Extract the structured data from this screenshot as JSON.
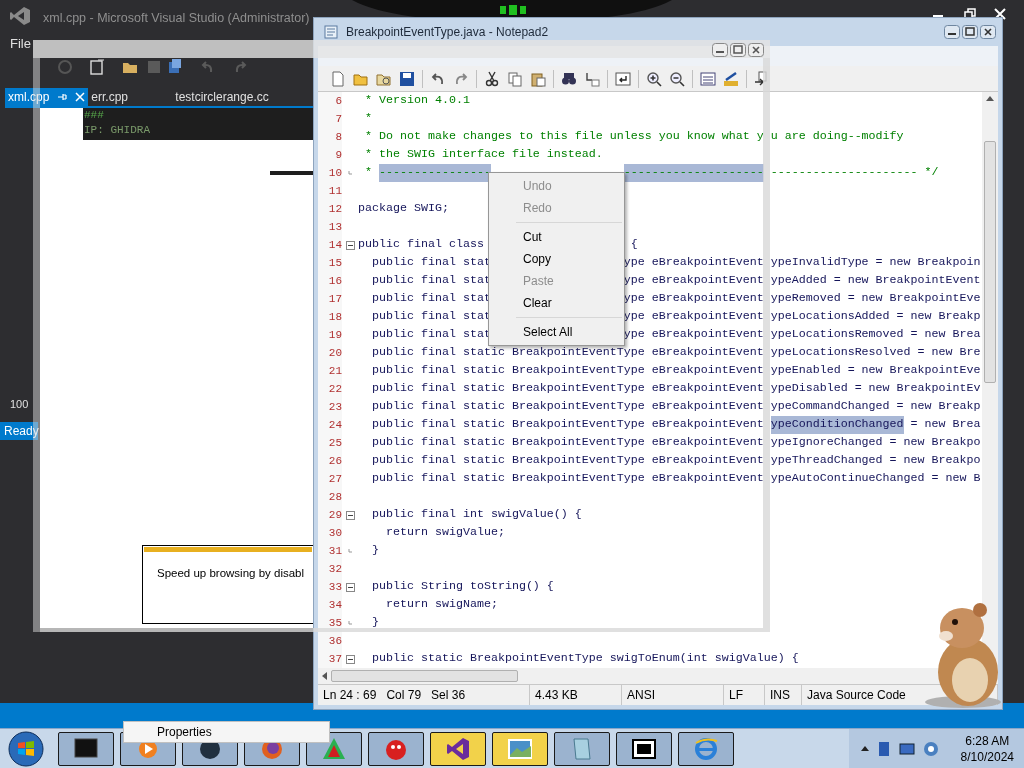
{
  "vs": {
    "title": "xml.cpp - Microsoft Visual Studio (Administrator)",
    "menu": [
      "File"
    ],
    "tabs": [
      {
        "label": "xml.cpp",
        "selected": true
      },
      {
        "label": "err.cpp",
        "selected": false
      },
      {
        "label": "testcirclerange.cc",
        "selected": false
      }
    ],
    "output_lines": [
      "###",
      "IP: GHIDRA"
    ],
    "zoom": "100",
    "status": "Ready"
  },
  "overlay_window": {
    "notification": "Speed up browsing by disabl"
  },
  "notepad": {
    "title": "BreakpointEventType.java - Notepad2",
    "lines": [
      {
        "number": "6",
        "kind": "comment",
        "left": [
          {
            "text": " * Version 4.0.1",
            "selected": false
          }
        ]
      },
      {
        "number": "7",
        "kind": "comment",
        "left": [
          {
            "text": " *",
            "selected": false
          }
        ]
      },
      {
        "number": "8",
        "kind": "comment",
        "left": [
          {
            "text": " * Do not make changes to this file unless you know what y",
            "selected": false
          }
        ],
        "right": [
          {
            "text": "u are doing--modify",
            "selected": false
          }
        ]
      },
      {
        "number": "9",
        "kind": "comment",
        "left": [
          {
            "text": " * the SWIG interface file instead.",
            "selected": false
          }
        ]
      },
      {
        "number": "10",
        "kind": "comment",
        "block_end": true,
        "left": [
          {
            "text": " * ",
            "selected": false
          },
          {
            "text": "----------------",
            "selected": true
          }
        ],
        "mid": [
          {
            "text": "--------------------",
            "selected": true
          }
        ],
        "right": [
          {
            "text": "--------------------- */",
            "selected": false
          }
        ]
      },
      {
        "number": "11",
        "kind": "blank"
      },
      {
        "number": "12",
        "kind": "code",
        "left": [
          {
            "text": "package SWIG;",
            "selected": false
          }
        ]
      },
      {
        "number": "13",
        "kind": "blank"
      },
      {
        "number": "14",
        "kind": "code",
        "collapsible": true,
        "left": [
          {
            "text": "public final class ",
            "selected": false
          }
        ],
        "mid": [
          {
            "text": " {",
            "selected": false
          }
        ]
      },
      {
        "number": "15",
        "kind": "code",
        "left": [
          {
            "text": "  public final stat",
            "selected": false
          }
        ],
        "mid": [
          {
            "text": "ype eBreakpointEvent",
            "selected": false
          }
        ],
        "right": [
          {
            "text": "ypeInvalidType = new Breakpoin",
            "selected": false
          }
        ]
      },
      {
        "number": "16",
        "kind": "code",
        "left": [
          {
            "text": "  public final stat",
            "selected": false
          }
        ],
        "mid": [
          {
            "text": "ype eBreakpointEvent",
            "selected": false
          }
        ],
        "right": [
          {
            "text": "ypeAdded = new BreakpointEvent",
            "selected": false
          }
        ]
      },
      {
        "number": "17",
        "kind": "code",
        "left": [
          {
            "text": "  public final stat",
            "selected": false
          }
        ],
        "mid": [
          {
            "text": "ype eBreakpointEvent",
            "selected": false
          }
        ],
        "right": [
          {
            "text": "ypeRemoved = new BreakpointEve",
            "selected": false
          }
        ]
      },
      {
        "number": "18",
        "kind": "code",
        "left": [
          {
            "text": "  public final stat",
            "selected": false
          }
        ],
        "mid": [
          {
            "text": "ype eBreakpointEvent",
            "selected": false
          }
        ],
        "right": [
          {
            "text": "ypeLocationsAdded = new Breakp",
            "selected": false
          }
        ]
      },
      {
        "number": "19",
        "kind": "code",
        "left": [
          {
            "text": "  public final stat",
            "selected": false
          }
        ],
        "mid": [
          {
            "text": "ype eBreakpointEvent",
            "selected": false
          }
        ],
        "right": [
          {
            "text": "ypeLocationsRemoved = new Brea",
            "selected": false
          }
        ]
      },
      {
        "number": "20",
        "kind": "code",
        "left": [
          {
            "text": "  public final static BreakpointEventType eBreakpointEvent",
            "selected": false
          }
        ],
        "right": [
          {
            "text": "ypeLocationsResolved = new Bre",
            "selected": false
          }
        ]
      },
      {
        "number": "21",
        "kind": "code",
        "left": [
          {
            "text": "  public final static BreakpointEventType eBreakpointEvent",
            "selected": false
          }
        ],
        "right": [
          {
            "text": "ypeEnabled = new BreakpointEve",
            "selected": false
          }
        ]
      },
      {
        "number": "22",
        "kind": "code",
        "left": [
          {
            "text": "  public final static BreakpointEventType eBreakpointEvent",
            "selected": false
          }
        ],
        "right": [
          {
            "text": "ypeDisabled = new BreakpointEv",
            "selected": false
          }
        ]
      },
      {
        "number": "23",
        "kind": "code",
        "left": [
          {
            "text": "  public final static BreakpointEventType eBreakpointEvent",
            "selected": false
          }
        ],
        "right": [
          {
            "text": "ypeCommandChanged = new Breakp",
            "selected": false
          }
        ]
      },
      {
        "number": "24",
        "kind": "code",
        "left": [
          {
            "text": "  public final static BreakpointEventType eBreakpointEvent",
            "selected": false
          }
        ],
        "right": [
          {
            "text": "ypeConditionChanged",
            "selected": true
          },
          {
            "text": " = new Brea",
            "selected": false
          }
        ]
      },
      {
        "number": "25",
        "kind": "code",
        "left": [
          {
            "text": "  public final static BreakpointEventType eBreakpointEvent",
            "selected": false
          }
        ],
        "right": [
          {
            "text": "ypeIgnoreChanged = new Breakpo",
            "selected": false
          }
        ]
      },
      {
        "number": "26",
        "kind": "code",
        "left": [
          {
            "text": "  public final static BreakpointEventType eBreakpointEvent",
            "selected": false
          }
        ],
        "right": [
          {
            "text": "ypeThreadChanged = new Breakpo",
            "selected": false
          }
        ]
      },
      {
        "number": "27",
        "kind": "code",
        "left": [
          {
            "text": "  public final static BreakpointEventType eBreakpointEvent",
            "selected": false
          }
        ],
        "right": [
          {
            "text": "ypeAutoContinueChanged = new B",
            "selected": false
          }
        ]
      },
      {
        "number": "28",
        "kind": "blank"
      },
      {
        "number": "29",
        "kind": "code",
        "collapsible": true,
        "left": [
          {
            "text": "  public final int swigValue() {",
            "selected": false
          }
        ]
      },
      {
        "number": "30",
        "kind": "code",
        "left": [
          {
            "text": "    return swigValue;",
            "selected": false
          }
        ]
      },
      {
        "number": "31",
        "kind": "code",
        "block_end": true,
        "left": [
          {
            "text": "  }",
            "selected": false
          }
        ]
      },
      {
        "number": "32",
        "kind": "blank"
      },
      {
        "number": "33",
        "kind": "code",
        "collapsible": true,
        "left": [
          {
            "text": "  public String toString() {",
            "selected": false
          }
        ]
      },
      {
        "number": "34",
        "kind": "code",
        "left": [
          {
            "text": "    return swigName;",
            "selected": false
          }
        ]
      },
      {
        "number": "35",
        "kind": "code",
        "block_end": true,
        "left": [
          {
            "text": "  }",
            "selected": false
          }
        ]
      },
      {
        "number": "36",
        "kind": "blank"
      },
      {
        "number": "37",
        "kind": "code",
        "collapsible": true,
        "left": [
          {
            "text": "  public static BreakpointEventType swigToEnum(int swigValue) {",
            "selected": false
          }
        ]
      }
    ],
    "context_menu": [
      {
        "kind": "item",
        "label": "Undo",
        "disabled": true
      },
      {
        "kind": "item",
        "label": "Redo",
        "disabled": true
      },
      {
        "kind": "separator"
      },
      {
        "kind": "item",
        "label": "Cut",
        "disabled": false
      },
      {
        "kind": "item",
        "label": "Copy",
        "disabled": false
      },
      {
        "kind": "item",
        "label": "Paste",
        "disabled": true
      },
      {
        "kind": "item",
        "label": "Clear",
        "disabled": false
      },
      {
        "kind": "separator"
      },
      {
        "kind": "item",
        "label": "Select All",
        "disabled": false
      }
    ],
    "status_bar": [
      "Ln 24 : 69",
      "Col 79",
      "Sel 36",
      "4.43 KB",
      "ANSI",
      "LF",
      "INS",
      "Java Source Code"
    ]
  },
  "taskbar": {
    "popup": "Properties",
    "items": [
      {
        "highlighted": false
      },
      {
        "highlighted": false
      },
      {
        "highlighted": false
      },
      {
        "highlighted": false
      },
      {
        "highlighted": false
      },
      {
        "highlighted": false
      },
      {
        "highlighted": true
      },
      {
        "highlighted": true
      },
      {
        "highlighted": false
      },
      {
        "highlighted": false
      },
      {
        "highlighted": false
      }
    ],
    "time": "6:28 AM",
    "date": "8/10/2024"
  }
}
